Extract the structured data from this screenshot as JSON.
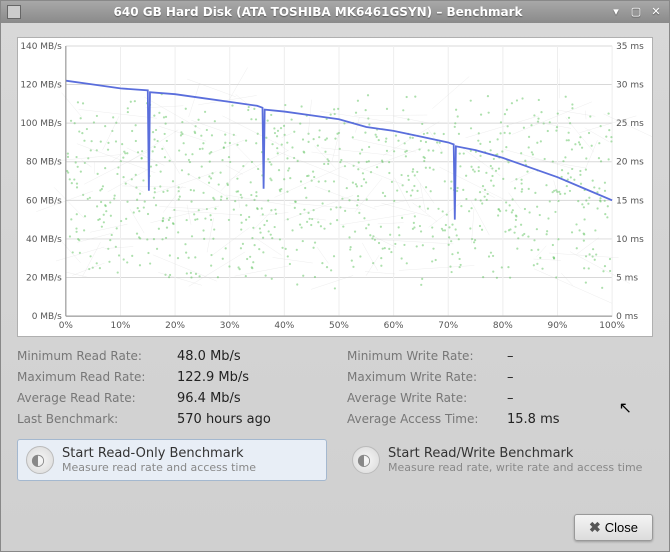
{
  "window": {
    "title": "640 GB Hard Disk (ATA TOSHIBA MK6461GSYN) – Benchmark"
  },
  "chart_data": {
    "type": "line",
    "title": "",
    "xlabel": "",
    "ylabel_left": "MB/s",
    "ylabel_right": "ms",
    "x_percent": [
      0,
      10,
      20,
      30,
      40,
      50,
      60,
      70,
      80,
      90,
      100
    ],
    "y_left_ticks": [
      "0 MB/s",
      "20 MB/s",
      "40 MB/s",
      "60 MB/s",
      "80 MB/s",
      "100 MB/s",
      "120 MB/s",
      "140 MB/s"
    ],
    "y_right_ticks": [
      "0 ms",
      "5 ms",
      "10 ms",
      "15 ms",
      "20 ms",
      "25 ms",
      "30 ms",
      "35 ms"
    ],
    "x_ticks": [
      "0%",
      "10%",
      "20%",
      "30%",
      "40%",
      "50%",
      "60%",
      "70%",
      "80%",
      "90%",
      "100%"
    ],
    "ylim_left": [
      0,
      140
    ],
    "ylim_right": [
      0,
      35
    ],
    "series": [
      {
        "name": "Read rate (MB/s)",
        "axis": "left",
        "color": "#5a6edc",
        "x": [
          0,
          5,
          10,
          15,
          15.2,
          15.4,
          20,
          25,
          30,
          35,
          36,
          36.2,
          36.4,
          40,
          45,
          50,
          55,
          60,
          65,
          70,
          71,
          71.2,
          71.4,
          75,
          80,
          85,
          90,
          95,
          100
        ],
        "y": [
          122,
          120,
          118,
          117,
          65,
          116,
          115,
          113,
          111,
          109,
          108,
          66,
          107,
          106,
          104,
          102,
          98,
          96,
          93,
          90,
          89,
          50,
          88,
          86,
          82,
          77,
          72,
          66,
          60
        ]
      },
      {
        "name": "Access time (ms)",
        "axis": "right",
        "kind": "scatter",
        "color": "#69c669",
        "note": "dense scatter between ~5 ms and ~30 ms across full range"
      }
    ]
  },
  "stats": {
    "left": [
      {
        "label": "Minimum Read Rate:",
        "value": "48.0 Mb/s"
      },
      {
        "label": "Maximum Read Rate:",
        "value": "122.9 Mb/s"
      },
      {
        "label": "Average Read Rate:",
        "value": "96.4 Mb/s"
      },
      {
        "label": "Last Benchmark:",
        "value": "570 hours ago"
      }
    ],
    "right": [
      {
        "label": "Minimum Write Rate:",
        "value": "–"
      },
      {
        "label": "Maximum Write Rate:",
        "value": "–"
      },
      {
        "label": "Average Write Rate:",
        "value": "–"
      },
      {
        "label": "Average Access Time:",
        "value": "15.8 ms"
      }
    ]
  },
  "bench": {
    "readonly": {
      "title": "Start Read-Only Benchmark",
      "sub": "Measure read rate and access time"
    },
    "readwrite": {
      "title": "Start Read/Write Benchmark",
      "sub": "Measure read rate, write rate and access time"
    }
  },
  "footer": {
    "close": "Close"
  }
}
